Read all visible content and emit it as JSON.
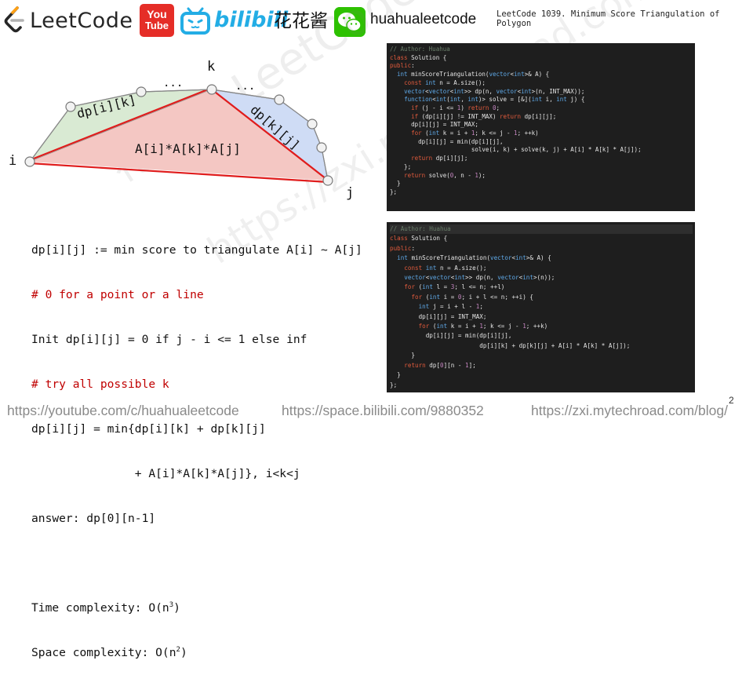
{
  "header": {
    "leetcode_brand": "LeetCode",
    "youtube_line1": "You",
    "youtube_line2": "Tube",
    "bilibili_word": "bilibili",
    "bilibili_cn": "花花酱",
    "handle": "huahualeetcode",
    "slide_title": "LeetCode 1039. Minimum Score Triangulation of Polygon"
  },
  "diagram": {
    "label_i": "i",
    "label_j": "j",
    "label_k": "k",
    "ellipsis_left": "...",
    "ellipsis_right": "...",
    "left_region": "dp[i][k]",
    "right_region": "dp[k][j]",
    "center_region": "A[i]*A[k]*A[j]",
    "colors": {
      "left_fill": "#d9ead3",
      "right_fill": "#cfdcf5",
      "center_fill": "#f4c7c3",
      "edge_red": "#e01c1c",
      "vertex": "#f2f2f2"
    }
  },
  "explain": {
    "l1": "dp[i][j] := min score to triangulate A[i] ~ A[j]",
    "l2": "# 0 for a point or a line",
    "l3": "Init dp[i][j] = 0 if j - i <= 1 else inf",
    "l4": "# try all possible k",
    "l5": "dp[i][j] = min{dp[i][k] + dp[k][j]",
    "l6": "               + A[i]*A[k]*A[j]}, i<k<j",
    "l7": "answer: dp[0][n-1]",
    "time_prefix": "Time complexity: O(n",
    "time_exp": "3",
    "time_suffix": ")",
    "space_prefix": "Space complexity: O(n",
    "space_exp": "2",
    "space_suffix": ")"
  },
  "code1": [
    "// Author: Huahua",
    "class Solution {",
    "public:",
    "  int minScoreTriangulation(vector<int>& A) {",
    "    const int n = A.size();",
    "    vector<vector<int>> dp(n, vector<int>(n, INT_MAX));",
    "    function<int(int, int)> solve = [&](int i, int j) {",
    "      if (j - i <= 1) return 0;",
    "      if (dp[i][j] != INT_MAX) return dp[i][j];",
    "      dp[i][j] = INT_MAX;",
    "      for (int k = i + 1; k <= j - 1; ++k)",
    "        dp[i][j] = min(dp[i][j],",
    "                       solve(i, k) + solve(k, j) + A[i] * A[k] * A[j]);",
    "      return dp[i][j];",
    "    };",
    "    return solve(0, n - 1);",
    "  }",
    "};"
  ],
  "code2": [
    "// Author: Huahua",
    "class Solution {",
    "public:",
    "  int minScoreTriangulation(vector<int>& A) {",
    "    const int n = A.size();",
    "    vector<vector<int>> dp(n, vector<int>(n));",
    "    for (int l = 3; l <= n; ++l)",
    "      for (int i = 0; i + l <= n; ++i) {",
    "        int j = i + l - 1;",
    "        dp[i][j] = INT_MAX;",
    "        for (int k = i + 1; k <= j - 1; ++k)",
    "          dp[i][j] = min(dp[i][j],",
    "                         dp[i][k] + dp[k][j] + A[i] * A[k] * A[j]);",
    "      }",
    "    return dp[0][n - 1];",
    "  }",
    "};"
  ],
  "watermark": {
    "line1": "花花酱 LeetCode",
    "line2": "https://zxi.mytechroad.com"
  },
  "footer": {
    "youtube_url": "https://youtube.com/c/huahualeetcode",
    "bilibili_url": "https://space.bilibili.com/9880352",
    "blog_url": "https://zxi.mytechroad.com/blog/",
    "page_number": "2"
  }
}
